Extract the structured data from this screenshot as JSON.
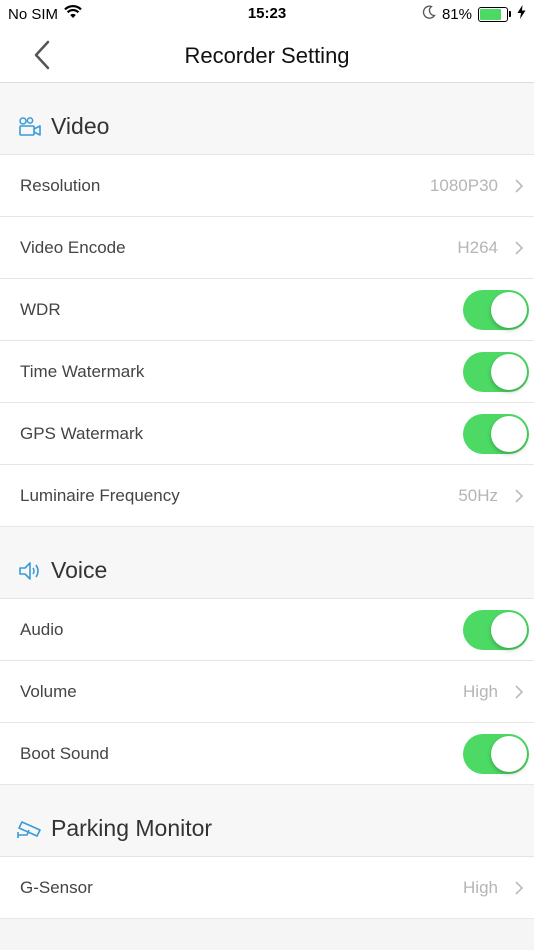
{
  "status_bar": {
    "carrier": "No SIM",
    "time": "15:23",
    "battery_percent": "81%",
    "battery_level": 0.81,
    "icons": [
      "wifi-icon",
      "moon-icon",
      "battery-icon",
      "charging-bolt-icon"
    ]
  },
  "nav": {
    "title": "Recorder Setting",
    "back_icon": "chevron-left-icon"
  },
  "colors": {
    "accent": "#3a9ad9",
    "toggle_on": "#4cd964",
    "value_text": "#b5b5b5"
  },
  "sections": {
    "video": {
      "title": "Video",
      "icon": "video-camera-icon",
      "rows": {
        "resolution": {
          "label": "Resolution",
          "value": "1080P30"
        },
        "video_encode": {
          "label": "Video Encode",
          "value": "H264"
        },
        "wdr": {
          "label": "WDR",
          "on": true
        },
        "time_watermark": {
          "label": "Time Watermark",
          "on": true
        },
        "gps_watermark": {
          "label": "GPS Watermark",
          "on": true
        },
        "luminaire_frequency": {
          "label": "Luminaire Frequency",
          "value": "50Hz"
        }
      }
    },
    "voice": {
      "title": "Voice",
      "icon": "speaker-icon",
      "rows": {
        "audio": {
          "label": "Audio",
          "on": true
        },
        "volume": {
          "label": "Volume",
          "value": "High"
        },
        "boot_sound": {
          "label": "Boot Sound",
          "on": true
        }
      }
    },
    "parking": {
      "title": "Parking Monitor",
      "icon": "security-camera-icon",
      "rows": {
        "g_sensor": {
          "label": "G-Sensor",
          "value": "High"
        }
      }
    }
  }
}
